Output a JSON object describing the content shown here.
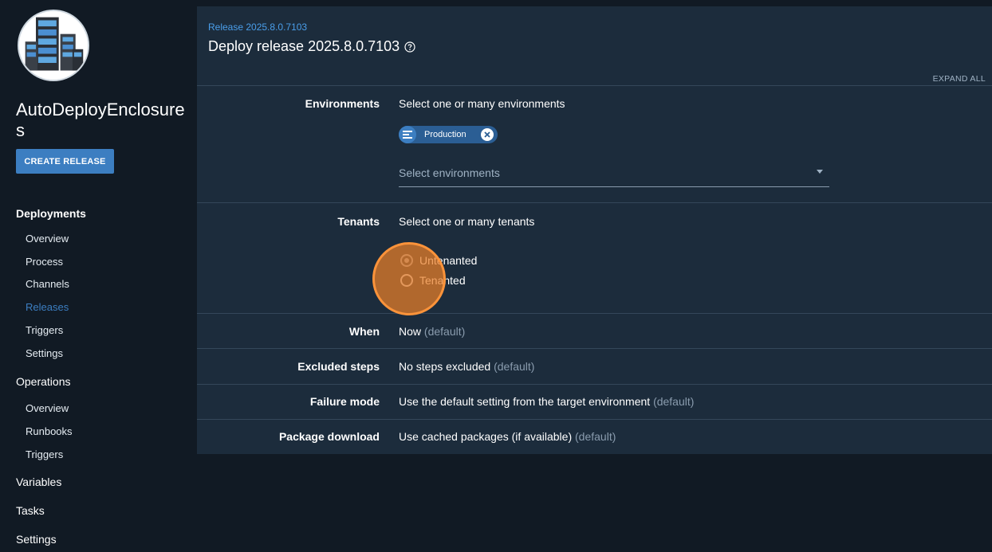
{
  "sidebar": {
    "project_name": "AutoDeployEnclosures",
    "create_release_label": "CREATE RELEASE",
    "sections": [
      {
        "label": "Deployments",
        "items": [
          {
            "label": "Overview",
            "active": false
          },
          {
            "label": "Process",
            "active": false
          },
          {
            "label": "Channels",
            "active": false
          },
          {
            "label": "Releases",
            "active": true
          },
          {
            "label": "Triggers",
            "active": false
          },
          {
            "label": "Settings",
            "active": false
          }
        ]
      },
      {
        "label": "Operations",
        "items": [
          {
            "label": "Overview",
            "active": false
          },
          {
            "label": "Runbooks",
            "active": false
          },
          {
            "label": "Triggers",
            "active": false
          }
        ]
      },
      {
        "label": "Variables",
        "items": []
      },
      {
        "label": "Tasks",
        "items": []
      },
      {
        "label": "Settings",
        "items": []
      }
    ]
  },
  "header": {
    "breadcrumb": "Release 2025.8.0.7103",
    "title": "Deploy release 2025.8.0.7103",
    "expand_all": "EXPAND ALL"
  },
  "environments": {
    "label": "Environments",
    "description": "Select one or many environments",
    "selected_chip": "Production",
    "placeholder": "Select environments"
  },
  "tenants": {
    "label": "Tenants",
    "description": "Select one or many tenants",
    "options": [
      {
        "label": "Untenanted",
        "checked": true
      },
      {
        "label": "Tenanted",
        "checked": false
      }
    ]
  },
  "rows": [
    {
      "label": "When",
      "value": "Now",
      "default": "(default)"
    },
    {
      "label": "Excluded steps",
      "value": "No steps excluded",
      "default": "(default)"
    },
    {
      "label": "Failure mode",
      "value": "Use the default setting from the target environment",
      "default": "(default)"
    },
    {
      "label": "Package download",
      "value": "Use cached packages (if available)",
      "default": "(default)"
    }
  ],
  "colors": {
    "accent": "#3c7ec1",
    "link": "#4a9eea",
    "panel": "#1c2c3c",
    "background": "#111a24",
    "click_marker": "#ec8028"
  }
}
